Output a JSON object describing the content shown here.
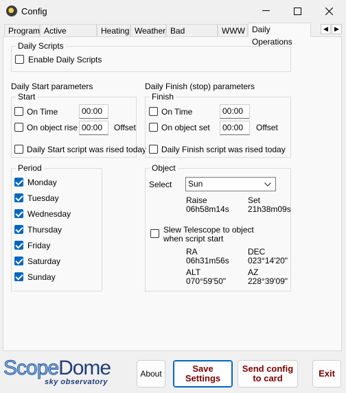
{
  "window": {
    "title": "Config"
  },
  "tabs": [
    {
      "label": "Program"
    },
    {
      "label": "Active Sensors"
    },
    {
      "label": "Heating"
    },
    {
      "label": "Weather"
    },
    {
      "label": "Bad Weather"
    },
    {
      "label": "WWW"
    },
    {
      "label": "Daily Operations"
    }
  ],
  "daily_scripts": {
    "group_label": "Daily Scripts",
    "enable_label": "Enable Daily Scripts",
    "enabled": false
  },
  "start": {
    "section_label": "Daily Start parameters",
    "group_label": "Start",
    "on_time_label": "On Time",
    "on_time_value": "00:00",
    "on_rise_label": "On object rise",
    "on_rise_value": "00:00",
    "offset_label": "Offset",
    "rised_label": "Daily Start script was rised today"
  },
  "finish": {
    "section_label": "Daily Finish (stop) parameters",
    "group_label": "Finish",
    "on_time_label": "On Time",
    "on_time_value": "00:00",
    "on_set_label": "On object set",
    "on_set_value": "00:00",
    "offset_label": "Offset",
    "rised_label": "Daily Finish script was rised today"
  },
  "period": {
    "group_label": "Period",
    "days": [
      {
        "label": "Monday",
        "checked": true
      },
      {
        "label": "Tuesday",
        "checked": true
      },
      {
        "label": "Wednesday",
        "checked": true
      },
      {
        "label": "Thursday",
        "checked": true
      },
      {
        "label": "Friday",
        "checked": true
      },
      {
        "label": "Saturday",
        "checked": true
      },
      {
        "label": "Sunday",
        "checked": true
      }
    ]
  },
  "object": {
    "group_label": "Object",
    "select_label": "Select",
    "selected": "Sun",
    "raise_label": "Raise",
    "raise_value": "06h58m14s",
    "set_label": "Set",
    "set_value": "21h38m09s",
    "slew_label_1": "Slew Telescope to object",
    "slew_label_2": "when script start",
    "ra_label": "RA",
    "ra_value": "06h31m56s",
    "dec_label": "DEC",
    "dec_value": "023°14'20\"",
    "alt_label": "ALT",
    "alt_value": "070°59'50\"",
    "az_label": "AZ",
    "az_value": "228°39'09\""
  },
  "logo": {
    "brand_scope": "Scope",
    "brand_dome": "Dome",
    "tagline": "sky observatory"
  },
  "buttons": {
    "about": "About",
    "save_1": "Save",
    "save_2": "Settings",
    "send_1": "Send config",
    "send_2": "to card",
    "exit": "Exit"
  }
}
